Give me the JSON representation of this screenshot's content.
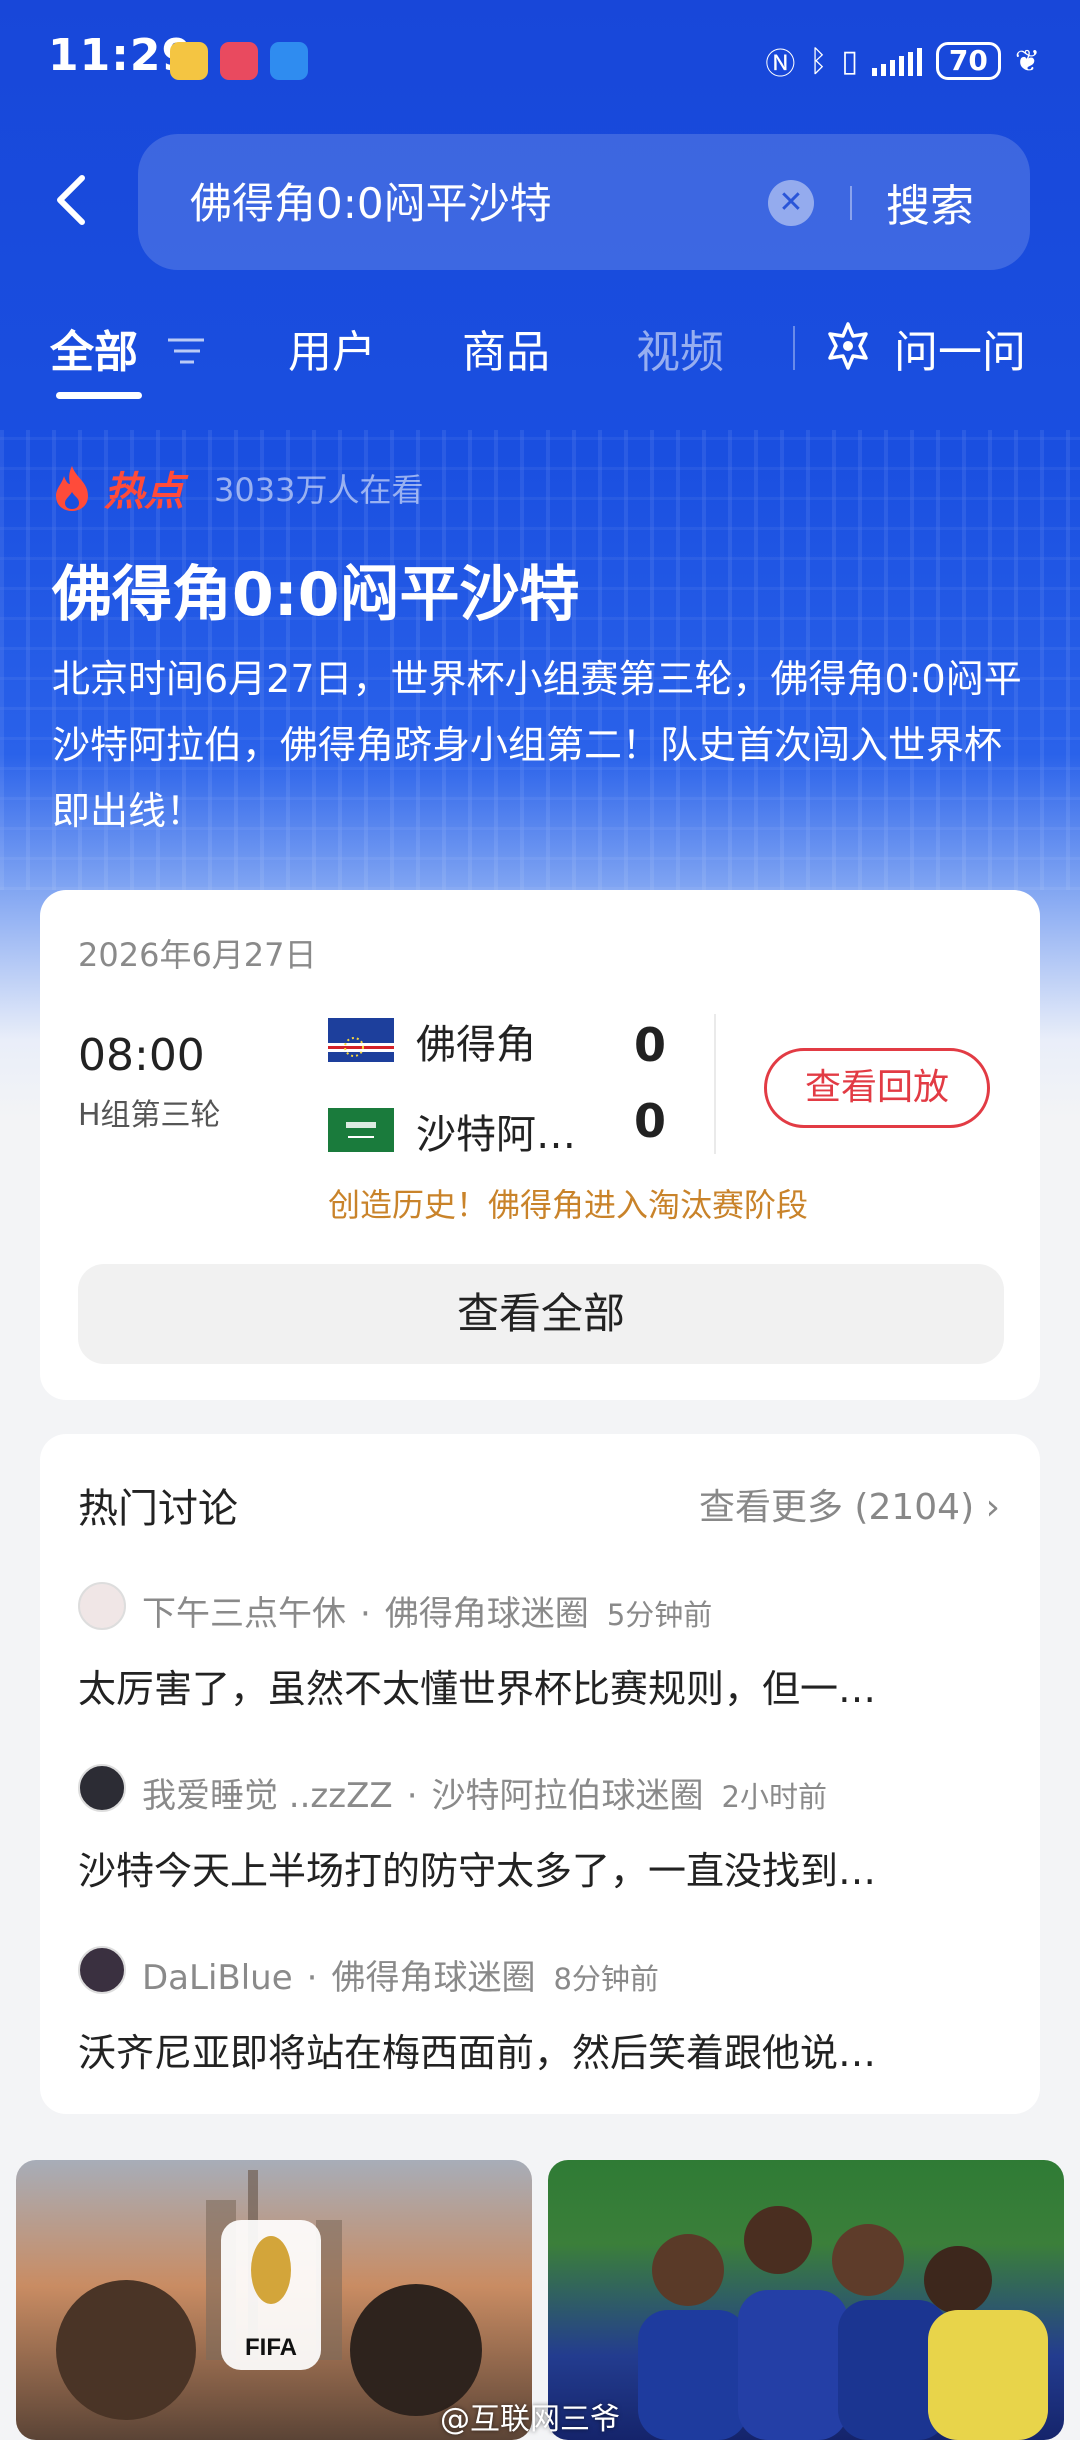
{
  "status_bar": {
    "time": "11:29",
    "battery": "70"
  },
  "search": {
    "query": "佛得角0:0闷平沙特",
    "button_label": "搜索"
  },
  "tabs": [
    {
      "label": "全部"
    },
    {
      "label": "用户"
    },
    {
      "label": "商品"
    },
    {
      "label": "视频"
    }
  ],
  "ask": {
    "label": "问一问"
  },
  "hot": {
    "label": "热点",
    "viewers": "3033万人在看",
    "headline": "佛得角0:0闷平沙特",
    "summary": "北京时间6月27日，世界杯小组赛第三轮，佛得角0:0闷平沙特阿拉伯，佛得角跻身小组第二！队史首次闯入世界杯即出线！"
  },
  "match": {
    "date": "2026年6月27日",
    "time": "08:00",
    "round": "H组第三轮",
    "home": {
      "name": "佛得角",
      "score": "0"
    },
    "away": {
      "name": "沙特阿…",
      "score": "0"
    },
    "replay_label": "查看回放",
    "note": "创造历史！佛得角进入淘汰赛阶段",
    "view_all_label": "查看全部"
  },
  "discussion": {
    "title": "热门讨论",
    "more_label": "查看更多 (2104)",
    "posts": [
      {
        "user": "下午三点午休",
        "circle": "佛得角球迷圈",
        "ago": "5分钟前",
        "text": "太厉害了，虽然不太懂世界杯比赛规则，但一…"
      },
      {
        "user": "我爱睡觉 ..zzZZ",
        "circle": "沙特阿拉伯球迷圈",
        "ago": "2小时前",
        "text": "沙特今天上半场打的防守太多了，一直没找到…"
      },
      {
        "user": "DaLiBlue",
        "circle": "佛得角球迷圈",
        "ago": "8分钟前",
        "text": "沃齐尼亚即将站在梅西面前，然后笑着跟他说…"
      }
    ]
  },
  "thumbnails": {
    "logo_text": "FIFA"
  },
  "watermark": "@互联网三爷",
  "colors": {
    "brand_blue": "#1a4fe0",
    "hot_red": "#ff4b3a",
    "replay_red": "#e23b44",
    "note_orange": "#c9832a"
  }
}
